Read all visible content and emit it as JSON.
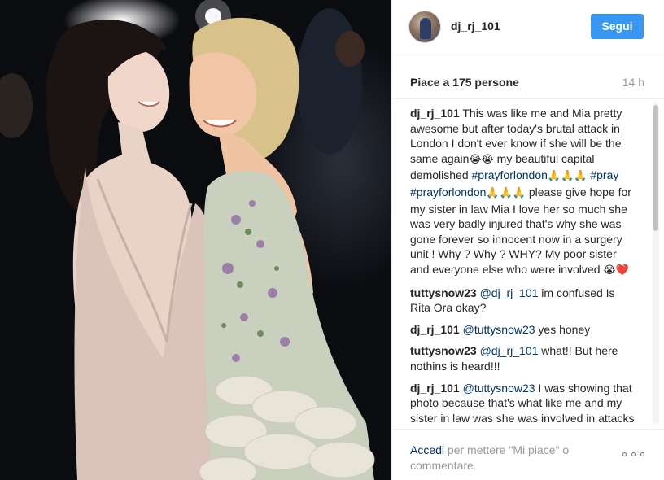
{
  "post": {
    "username": "dj_rj_101",
    "follow_label": "Segui",
    "likes": "Piace a 175 persone",
    "time": "14 h"
  },
  "caption": {
    "user": "dj_rj_101",
    "text_1": " This was like me and Mia pretty awesome but after today's brutal attack in London I don't ever know if she will be the same again",
    "emoji_1": "😭😭",
    "text_2": " my beautiful capital demolished ",
    "hashtag_1": "#prayforlondon",
    "emoji_2": "🙏🙏🙏",
    "hashtag_2": "#pray",
    "hashtag_3": "#prayforlondon",
    "emoji_3": "🙏🙏🙏",
    "text_3": " please give hope for my sister in law Mia I love her so much she was very badly injured that's why she was gone forever so innocent now in a surgery unit ! Why ? Why ? WHY? My poor sister and everyone else who were involved ",
    "emoji_4": "😭❤️"
  },
  "comments": [
    {
      "user": "tuttysnow23",
      "mention": "@dj_rj_101",
      "text": " im confused Is Rita Ora okay?"
    },
    {
      "user": "dj_rj_101",
      "mention": "@tuttysnow23",
      "text": " yes honey"
    },
    {
      "user": "tuttysnow23",
      "mention": "@dj_rj_101",
      "text": " what!! But here nothins is heard!!!"
    },
    {
      "user": "dj_rj_101",
      "mention": "@tuttysnow23",
      "text": " I was showing that photo because that's what like me and my sister in law was she was involved in attacks today at Rita instead"
    }
  ],
  "footer": {
    "login_link": "Accedi",
    "text": " per mettere \"Mi piace\" o commentare."
  },
  "icons": {
    "more": "more-options-icon"
  },
  "colors": {
    "accent": "#3897f0",
    "link": "#003569",
    "muted": "#999999"
  }
}
